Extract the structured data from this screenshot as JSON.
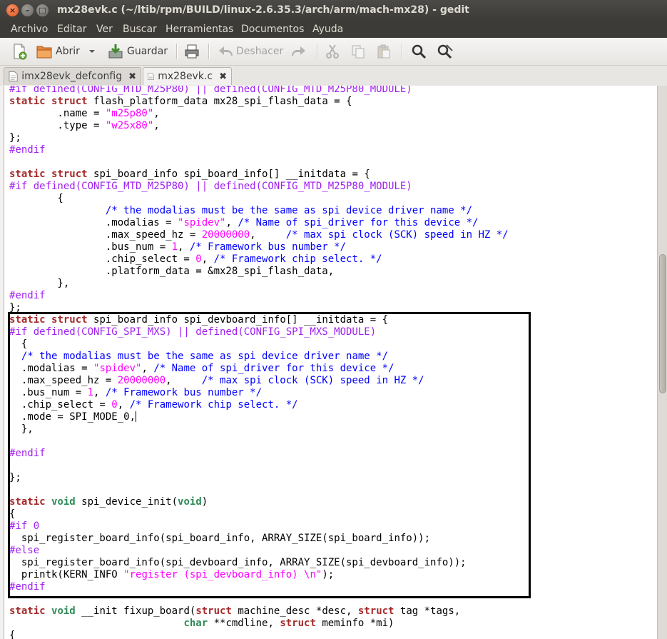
{
  "window": {
    "title": "mx28evk.c (~/ltib/rpm/BUILD/linux-2.6.35.3/arch/arm/mach-mx28) - gedit",
    "controls": {
      "close": "×",
      "minimize": "–",
      "maximize": "□"
    }
  },
  "menu": [
    "Archivo",
    "Editar",
    "Ver",
    "Buscar",
    "Herramientas",
    "Documentos",
    "Ayuda"
  ],
  "toolbar": {
    "new_icon": "new-document-icon",
    "open_label": "Abrir",
    "save_label": "Guardar",
    "print_icon": "printer-icon",
    "undo_label": "Deshacer",
    "redo_icon": "redo-icon",
    "cut_icon": "cut-icon",
    "copy_icon": "copy-icon",
    "paste_icon": "paste-icon",
    "find_icon": "search-icon",
    "replace_icon": "find-replace-icon"
  },
  "tabs": [
    {
      "label": "imx28evk_defconfig",
      "active": false,
      "close": "✖"
    },
    {
      "label": "mx28evk.c",
      "active": true,
      "close": "✖"
    }
  ],
  "editor": {
    "language": "C",
    "lines": [
      "#if defined(CONFIG_MTD_M25P80) || defined(CONFIG_MTD_M25P80_MODULE)",
      "static struct flash_platform_data mx28_spi_flash_data = {",
      "        .name = \"m25p80\",",
      "        .type = \"w25x80\",",
      "};",
      "#endif",
      "",
      "static struct spi_board_info spi_board_info[] __initdata = {",
      "#if defined(CONFIG_MTD_M25P80) || defined(CONFIG_MTD_M25P80_MODULE)",
      "        {",
      "                /* the modalias must be the same as spi device driver name */",
      "                .modalias = \"spidev\", /* Name of spi_driver for this device */",
      "                .max_speed_hz = 20000000,     /* max spi clock (SCK) speed in HZ */",
      "                .bus_num = 1, /* Framework bus number */",
      "                .chip_select = 0, /* Framework chip select. */",
      "                .platform_data = &mx28_spi_flash_data,",
      "        },",
      "#endif",
      "};",
      "static struct spi_board_info spi_devboard_info[] __initdata = {",
      "#if defined(CONFIG_SPI_MXS) || defined(CONFIG_SPI_MXS_MODULE)",
      "  {",
      "  /* the modalias must be the same as spi device driver name */",
      "  .modalias = \"spidev\", /* Name of spi_driver for this device */",
      "  .max_speed_hz = 20000000,     /* max spi clock (SCK) speed in HZ */",
      "  .bus_num = 1, /* Framework bus number */",
      "  .chip_select = 0, /* Framework chip select. */",
      "  .mode = SPI_MODE_0,",
      "  },",
      "",
      "#endif",
      "",
      "};",
      "",
      "static void spi_device_init(void)",
      "{",
      "#if 0",
      "  spi_register_board_info(spi_board_info, ARRAY_SIZE(spi_board_info));",
      "#else",
      "  spi_register_board_info(spi_devboard_info, ARRAY_SIZE(spi_devboard_info));",
      "  printk(KERN_INFO \"register (spi_devboard_info) \\n\");",
      "#endif",
      "",
      "static void __init fixup_board(struct machine_desc *desc, struct tag *tags,",
      "                             char **cmdline, struct meminfo *mi)",
      "{"
    ],
    "cursor_line": 28
  },
  "colors": {
    "titlebar": "#3c3b37",
    "title_text": "#dfdbd2",
    "close_button": "#e3531b",
    "keyword": "#a52a2a",
    "type": "#2e8b57",
    "preprocessor": "#a020f0",
    "comment": "#0000ff",
    "string": "#ff00ff",
    "highlight_border": "#000000"
  }
}
